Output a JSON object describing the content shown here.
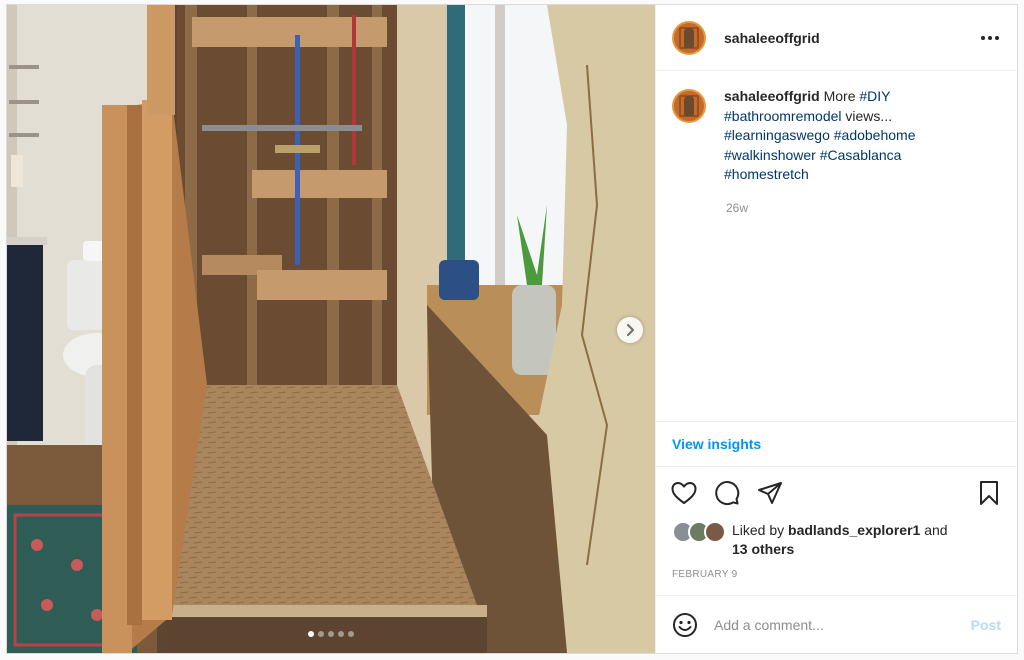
{
  "post": {
    "username": "sahaleeoffgrid",
    "caption": {
      "username": "sahaleeoffgrid",
      "text_before": " More ",
      "tags": [
        "#DIY",
        "#bathroomremodel",
        "#learningaswego",
        "#adobehome",
        "#walkinshower",
        "#Casablanca",
        "#homestretch"
      ],
      "text_after_second_tag": " views..."
    },
    "time_ago": "26w",
    "view_insights_label": "View insights",
    "likes": {
      "prefix": "Liked by ",
      "user": "badlands_explorer1",
      "middle": " and",
      "others": "13 others"
    },
    "date": "FEBRUARY 9",
    "comment_placeholder": "Add a comment...",
    "post_label": "Post",
    "carousel": {
      "total": 5,
      "active_index": 0
    }
  },
  "icons": {
    "more": "more-options-icon",
    "next": "chevron-right-icon",
    "like": "heart-icon",
    "comment": "comment-icon",
    "share": "share-icon",
    "save": "bookmark-icon",
    "emoji": "emoji-icon"
  },
  "colors": {
    "link_blue": "#0095f6",
    "hashtag_blue": "#00376b",
    "muted_gray": "#8e8e8e",
    "post_disabled": "#b3dbff"
  }
}
